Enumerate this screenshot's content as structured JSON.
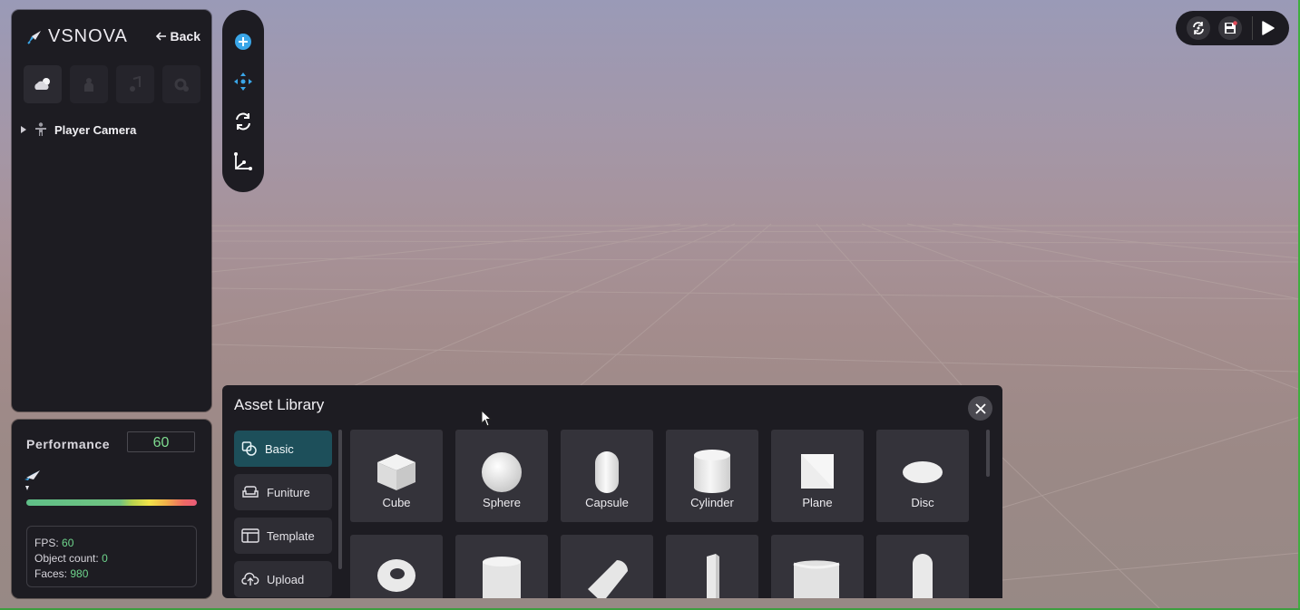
{
  "app": {
    "brand": "VSNOVA",
    "back_label": "Back"
  },
  "hierarchy": {
    "tabs": [
      "environment-tab",
      "avatar-tab",
      "audio-tab",
      "settings-tab"
    ],
    "items": [
      {
        "label": "Player Camera",
        "icon": "person-icon",
        "expanded": false
      }
    ]
  },
  "performance": {
    "label": "Performance",
    "value": "60",
    "stats": {
      "fps_label": "FPS:",
      "fps_value": "60",
      "objects_label": "Object count:",
      "objects_value": "0",
      "faces_label": "Faces:",
      "faces_value": "980"
    }
  },
  "toolbar": {
    "tools": [
      "add-icon",
      "move-icon",
      "rotate-icon",
      "axis-icon"
    ]
  },
  "top_controls": [
    "sync-icon",
    "save-icon",
    "play-icon"
  ],
  "asset_library": {
    "title": "Asset Library",
    "categories": [
      {
        "label": "Basic",
        "icon": "shapes-icon",
        "active": true
      },
      {
        "label": "Funiture",
        "icon": "sofa-icon",
        "active": false
      },
      {
        "label": "Template",
        "icon": "template-icon",
        "active": false
      },
      {
        "label": "Upload",
        "icon": "upload-icon",
        "active": false
      }
    ],
    "assets": [
      {
        "label": "Cube"
      },
      {
        "label": "Sphere"
      },
      {
        "label": "Capsule"
      },
      {
        "label": "Cylinder"
      },
      {
        "label": "Plane"
      },
      {
        "label": "Disc"
      }
    ],
    "assets_row2": [
      "torus",
      "half-cylinder",
      "wedge",
      "thin-box",
      "rounded-box",
      "arch"
    ]
  },
  "colors": {
    "panel": "#1d1c22",
    "accent": "#1d4f5a",
    "stat_value": "#6ed58c",
    "tool_accent": "#3aa6e8"
  }
}
